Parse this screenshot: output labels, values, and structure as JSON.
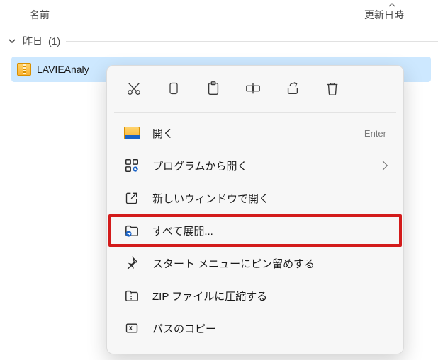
{
  "columns": {
    "name": "名前",
    "date": "更新日時"
  },
  "group": {
    "label": "昨日",
    "count": "(1)"
  },
  "file": {
    "name": "LAVIEAnaly"
  },
  "menu": {
    "open": {
      "label": "開く",
      "accel": "Enter"
    },
    "open_with": {
      "label": "プログラムから開く"
    },
    "new_window": {
      "label": "新しいウィンドウで開く"
    },
    "extract_all": {
      "label": "すべて展開..."
    },
    "pin_start": {
      "label": "スタート メニューにピン留めする"
    },
    "compress": {
      "label": "ZIP ファイルに圧縮する"
    },
    "copy_path": {
      "label": "パスのコピー"
    }
  }
}
